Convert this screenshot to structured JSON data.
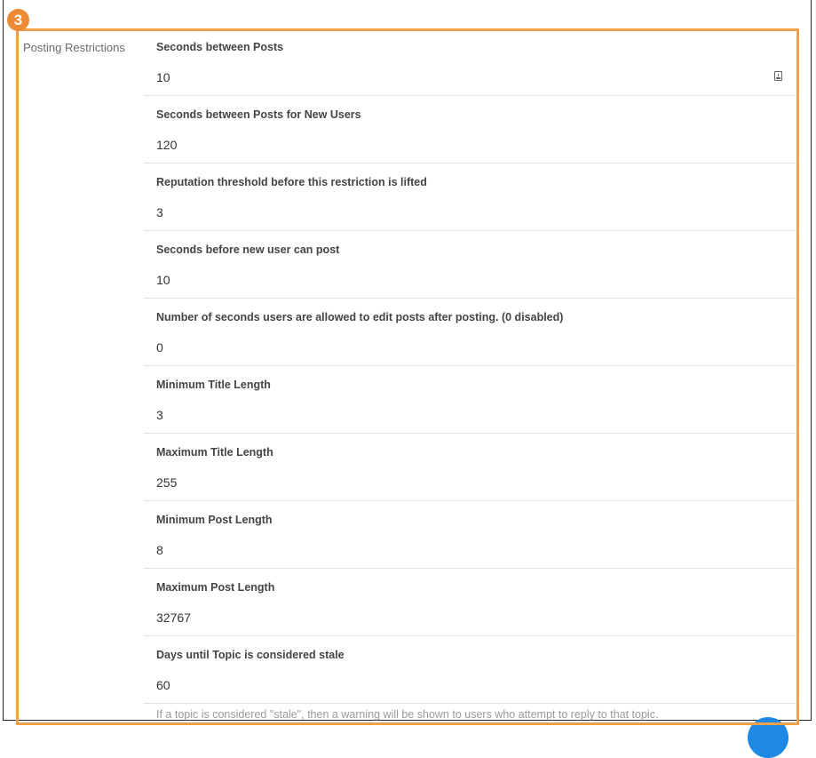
{
  "annotation": {
    "step_number": "3",
    "highlight_color": "#f0a04b"
  },
  "section": {
    "label": "Posting Restrictions"
  },
  "fields": [
    {
      "label": "Seconds between Posts",
      "value": "10"
    },
    {
      "label": "Seconds between Posts for New Users",
      "value": "120"
    },
    {
      "label": "Reputation threshold before this restriction is lifted",
      "value": "3"
    },
    {
      "label": "Seconds before new user can post",
      "value": "10"
    },
    {
      "label": "Number of seconds users are allowed to edit posts after posting. (0 disabled)",
      "value": "0"
    },
    {
      "label": "Minimum Title Length",
      "value": "3"
    },
    {
      "label": "Maximum Title Length",
      "value": "255"
    },
    {
      "label": "Minimum Post Length",
      "value": "8"
    },
    {
      "label": "Maximum Post Length",
      "value": "32767"
    },
    {
      "label": "Days until Topic is considered stale",
      "value": "60"
    }
  ],
  "stale_help": "If a topic is considered \"stale\", then a warning will be shown to users who attempt to reply to that topic.",
  "icons": {
    "first_field_icon": "contact-card-icon",
    "floating_button": "save-fab"
  },
  "colors": {
    "accent": "#ee8a33",
    "fab": "#1e88e5"
  }
}
